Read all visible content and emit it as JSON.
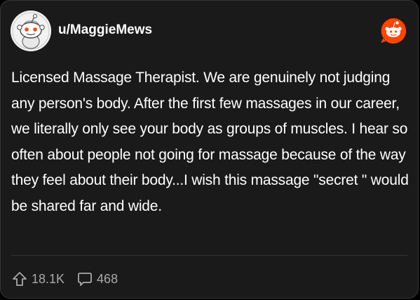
{
  "post": {
    "username": "u/MaggieMews",
    "body": "Licensed Massage Therapist. We are genuinely not judging any person's body. After the first few massages in our career, we literally only see your body as groups of muscles. I hear so often about people not going for massage because of the way they feel about their body...I wish this massage \"secret \" would be shared far and wide.",
    "upvotes": "18.1K",
    "comments": "468"
  },
  "icons": {
    "avatar": "snoo-avatar-icon",
    "logo": "reddit-logo-icon",
    "upvote": "upvote-arrow-icon",
    "comment": "comment-bubble-icon"
  },
  "colors": {
    "background": "#1a1a1b",
    "text": "#ffffff",
    "muted": "#a9a9ab",
    "brand": "#ff4500"
  }
}
